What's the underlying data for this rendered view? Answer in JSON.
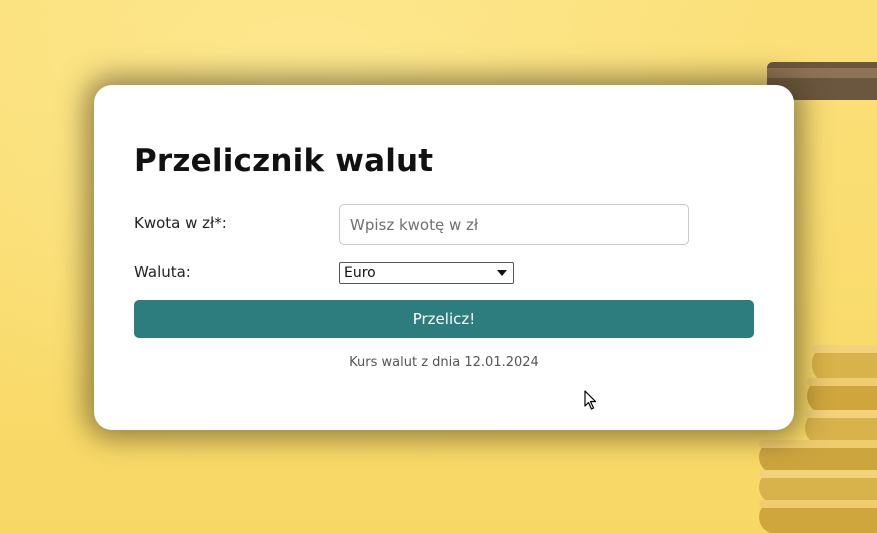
{
  "converter": {
    "title": "Przelicznik walut",
    "amount_label": "Kwota w zł*:",
    "amount_placeholder": "Wpisz kwotę w zł",
    "amount_value": "",
    "currency_label": "Waluta:",
    "currency_selected": "Euro",
    "submit_label": "Przelicz!",
    "rate_date_text": "Kurs walut z dnia 12.01.2024"
  },
  "theme": {
    "background": "#fbe07a",
    "card": "#ffffff",
    "button": "#2d7c7e",
    "button_text": "#ffffff"
  }
}
